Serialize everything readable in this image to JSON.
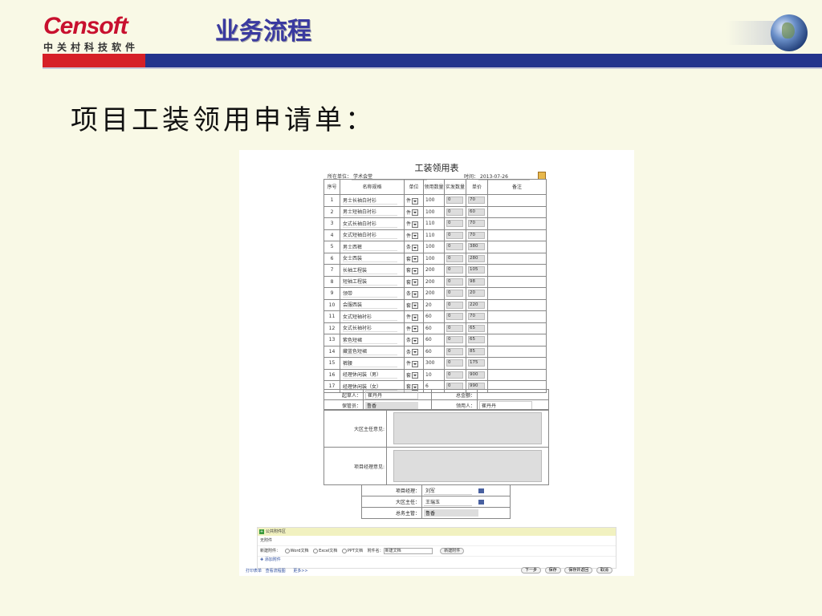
{
  "header": {
    "logo_main": "Censoft",
    "logo_sub": "中关村科技软件",
    "title": "业务流程"
  },
  "heading": "项目工装领用申请单：",
  "form": {
    "title": "工装领用表",
    "unit_label": "所在单位：",
    "unit_value": "学术会堂",
    "time_label": "时间：",
    "time_value": "2013-07-26",
    "columns": [
      "序号",
      "名称规格",
      "单位",
      "领用数量",
      "实发数量",
      "单价",
      "备注"
    ],
    "rows": [
      {
        "no": "1",
        "name": "男士长袖白衬衫",
        "unit": "件",
        "qty": "100",
        "act": "0",
        "price": "70"
      },
      {
        "no": "2",
        "name": "男士短袖白衬衫",
        "unit": "件",
        "qty": "100",
        "act": "0",
        "price": "60"
      },
      {
        "no": "3",
        "name": "女式长袖白衬衫",
        "unit": "件",
        "qty": "110",
        "act": "0",
        "price": "70"
      },
      {
        "no": "4",
        "name": "女式短袖白衬衫",
        "unit": "件",
        "qty": "110",
        "act": "0",
        "price": "70"
      },
      {
        "no": "5",
        "name": "男士西裤",
        "unit": "条",
        "qty": "100",
        "act": "0",
        "price": "380"
      },
      {
        "no": "6",
        "name": "女士西装",
        "unit": "套",
        "qty": "100",
        "act": "0",
        "price": "280"
      },
      {
        "no": "7",
        "name": "长袖工程装",
        "unit": "套",
        "qty": "200",
        "act": "0",
        "price": "105"
      },
      {
        "no": "8",
        "name": "短袖工程装",
        "unit": "套",
        "qty": "200",
        "act": "0",
        "price": "98"
      },
      {
        "no": "9",
        "name": "领带",
        "unit": "条",
        "qty": "200",
        "act": "0",
        "price": "20"
      },
      {
        "no": "10",
        "name": "会服西装",
        "unit": "套",
        "qty": "20",
        "act": "0",
        "price": "220"
      },
      {
        "no": "11",
        "name": "女式短袖衬衫",
        "unit": "件",
        "qty": "60",
        "act": "0",
        "price": "70"
      },
      {
        "no": "12",
        "name": "女式长袖衬衫",
        "unit": "件",
        "qty": "60",
        "act": "0",
        "price": "65"
      },
      {
        "no": "13",
        "name": "紫色短裙",
        "unit": "条",
        "qty": "60",
        "act": "0",
        "price": "65"
      },
      {
        "no": "14",
        "name": "藏蓝色短裙",
        "unit": "条",
        "qty": "60",
        "act": "0",
        "price": "85"
      },
      {
        "no": "15",
        "name": "裤腰",
        "unit": "件",
        "qty": "300",
        "act": "0",
        "price": "175"
      },
      {
        "no": "16",
        "name": "经理休闲装（男）",
        "unit": "套",
        "qty": "10",
        "act": "0",
        "price": "900"
      },
      {
        "no": "17",
        "name": "经理休闲装（女）",
        "unit": "套",
        "qty": "6",
        "act": "0",
        "price": "990"
      }
    ],
    "footer": {
      "applicant_label": "起草人：",
      "applicant_value": "崔丹丹",
      "total_label": "总金额：",
      "total_value": "",
      "keeper_label": "保管员：",
      "keeper_value": "鲁香",
      "receiver_label": "领用人：",
      "receiver_value": "崔丹丹"
    },
    "opinions": {
      "director_label": "大区主任意见:",
      "pm_label": "项目经理意见:"
    },
    "approval": [
      {
        "label": "项目经理：",
        "value": "刘军"
      },
      {
        "label": "大区主任：",
        "value": "王瑞玉"
      },
      {
        "label": "总务主管：",
        "value": "鲁香"
      }
    ]
  },
  "attach": {
    "title": "公共附件区",
    "none": "无附件",
    "new_label": "新建附件：",
    "opt_word": "Word文档",
    "opt_excel": "Excel文档",
    "opt_ppt": "PPT文档",
    "name_label": "附件名：",
    "name_value": "新建文档",
    "create_btn": "新建附件",
    "add_link": "✚ 添加附件"
  },
  "bottom": {
    "print_link": "打印表单",
    "flow_link": "查看流程图",
    "more_link": "更多>>",
    "buttons": [
      "下一步",
      "保存",
      "保存并返回",
      "取消"
    ]
  }
}
